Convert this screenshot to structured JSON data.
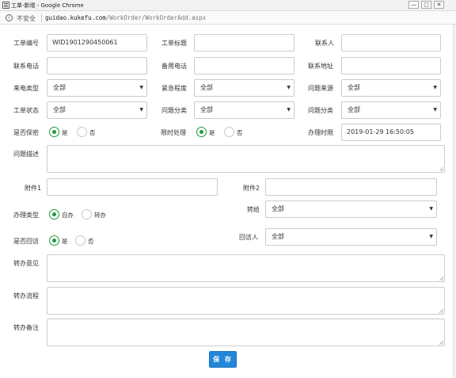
{
  "window": {
    "title": "工单-新增 - Google Chrome",
    "min_glyph": "—",
    "max_glyph": "▢",
    "close_glyph": "✕"
  },
  "address": {
    "security_label": "不安全",
    "url_host": "guidao.kukefu.com",
    "url_path": "/WorkOrder/WorkOrderAdd.aspx"
  },
  "form": {
    "work_order_no": {
      "label": "工单编号",
      "value": "WID1901290450061"
    },
    "work_order_title": {
      "label": "工单标题",
      "value": ""
    },
    "contact": {
      "label": "联系人",
      "value": ""
    },
    "phone": {
      "label": "联系电话",
      "value": ""
    },
    "backup_phone": {
      "label": "备用电话",
      "value": ""
    },
    "address": {
      "label": "联系地址",
      "value": ""
    },
    "call_type": {
      "label": "来电类型",
      "selected": "全部"
    },
    "urgency": {
      "label": "紧急程度",
      "selected": "全部"
    },
    "issue_source": {
      "label": "问题来源",
      "selected": "全部"
    },
    "status": {
      "label": "工单状态",
      "selected": "全部"
    },
    "issue_category": {
      "label": "问题分类",
      "selected": "全部"
    },
    "issue_category_2": {
      "label": "问题分类",
      "selected": "全部"
    },
    "confidential": {
      "label": "是否保密",
      "yes": "是",
      "no": "否",
      "selected": "yes"
    },
    "time_limited": {
      "label": "限时处理",
      "yes": "是",
      "no": "否",
      "selected": "yes"
    },
    "deadline": {
      "label": "办理时限",
      "value": "2019-01-29 16:50:05"
    },
    "description": {
      "label": "问题描述",
      "value": ""
    },
    "attachment1": {
      "label": "附件1",
      "value": ""
    },
    "attachment2": {
      "label": "附件2",
      "value": ""
    },
    "handle_type": {
      "label": "办理类型",
      "self": "自办",
      "transfer": "转办",
      "selected": "self"
    },
    "transfer_to": {
      "label": "转给",
      "selected": "全部"
    },
    "revisit": {
      "label": "是否回访",
      "yes": "是",
      "no": "否",
      "selected": "yes"
    },
    "revisitor": {
      "label": "回访人",
      "selected": "全部"
    },
    "transfer_opinion": {
      "label": "转办意见",
      "value": ""
    },
    "transfer_flow": {
      "label": "转办流程",
      "value": ""
    },
    "transfer_note": {
      "label": "转办备注",
      "value": ""
    }
  },
  "actions": {
    "save_label": "保 存"
  },
  "colors": {
    "accent": "#2387d9",
    "radio_on": "#1f9b3b",
    "border": "#cccccc"
  },
  "icons": {
    "select_caret": "caret-down-icon",
    "info": "info-icon",
    "window_app": "app-icon"
  }
}
